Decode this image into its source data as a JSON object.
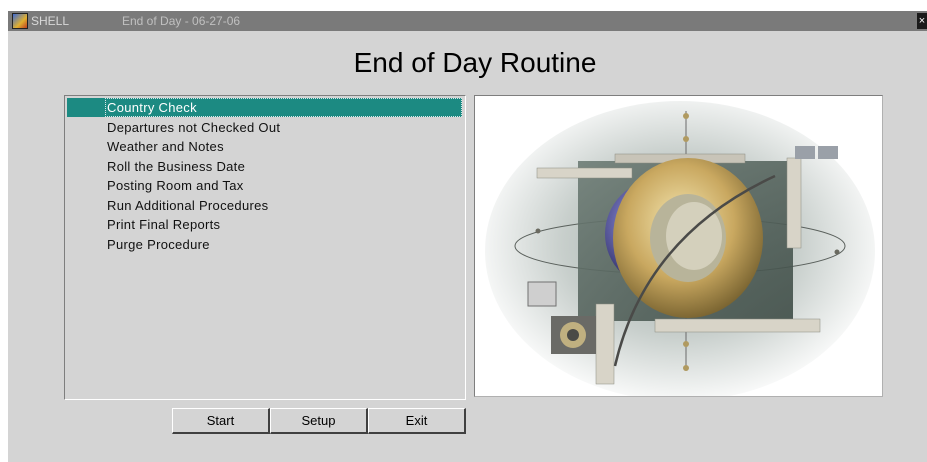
{
  "titlebar": {
    "app_name": "SHELL",
    "title": "End of Day - 06-27-06",
    "close_glyph": "×"
  },
  "heading": "End of Day Routine",
  "procedures": [
    {
      "label": "Country Check",
      "selected": true
    },
    {
      "label": "Departures not Checked Out",
      "selected": false
    },
    {
      "label": "Weather and Notes",
      "selected": false
    },
    {
      "label": "Roll the Business Date",
      "selected": false
    },
    {
      "label": "Posting Room and Tax",
      "selected": false
    },
    {
      "label": "Run Additional Procedures",
      "selected": false
    },
    {
      "label": "Print Final Reports",
      "selected": false
    },
    {
      "label": "Purge Procedure",
      "selected": false
    }
  ],
  "buttons": {
    "start": "Start",
    "setup": "Setup",
    "exit": "Exit"
  },
  "colors": {
    "selection": "#1c8a82",
    "titlebar": "#7a7a7a",
    "window_bg": "#d4d4d4"
  }
}
